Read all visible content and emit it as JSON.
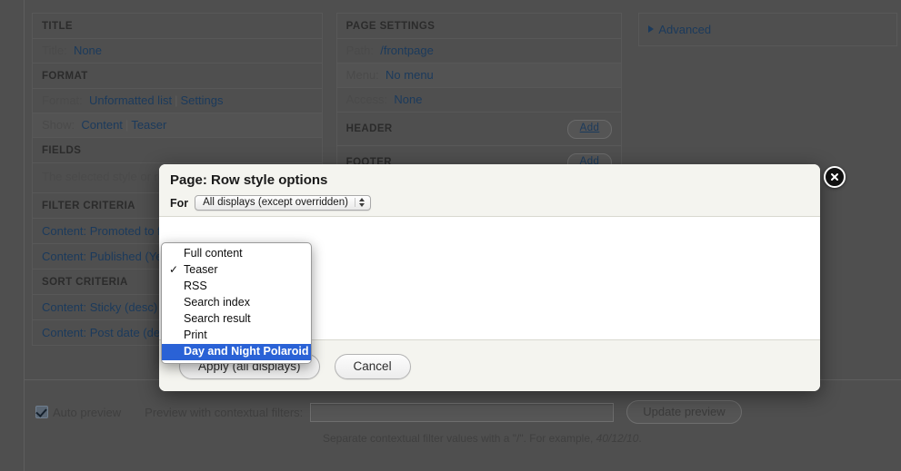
{
  "background": {
    "columns": [
      {
        "id": "col-1",
        "sections": [
          {
            "id": "title",
            "heading": "TITLE",
            "rows": [
              {
                "label": "Title:",
                "links": [
                  "None"
                ]
              }
            ]
          },
          {
            "id": "format",
            "heading": "FORMAT",
            "rows": [
              {
                "label": "Format:",
                "links": [
                  "Unformatted list",
                  "Settings"
                ]
              },
              {
                "label": "Show:",
                "links": [
                  "Content",
                  "Teaser"
                ]
              }
            ]
          },
          {
            "id": "fields",
            "heading": "FIELDS",
            "description": "The selected style or row style does not use fields."
          },
          {
            "id": "filter-criteria",
            "heading": "FILTER CRITERIA",
            "criteria": [
              "Content: Promoted to front page (= Yes)",
              "Content: Published (Yes)"
            ]
          },
          {
            "id": "sort-criteria",
            "heading": "SORT CRITERIA",
            "criteria": [
              "Content: Sticky (desc)",
              "Content: Post date (desc)"
            ]
          }
        ]
      },
      {
        "id": "col-2",
        "sections": [
          {
            "id": "page-settings",
            "heading": "PAGE SETTINGS",
            "rows": [
              {
                "label": "Path:",
                "links": [
                  "/frontpage"
                ]
              },
              {
                "label": "Menu:",
                "links": [
                  "No menu"
                ]
              },
              {
                "label": "Access:",
                "links": [
                  "None"
                ]
              }
            ]
          },
          {
            "id": "header",
            "heading": "HEADER",
            "action": "Add"
          },
          {
            "id": "footer",
            "heading": "FOOTER",
            "action": "Add"
          }
        ]
      }
    ],
    "advanced": {
      "label": "Advanced",
      "icon": "triangle-right-icon"
    }
  },
  "preview": {
    "auto_preview_label": "Auto preview",
    "auto_preview_checked": true,
    "contextual_label": "Preview with contextual filters:",
    "contextual_value": "",
    "contextual_placeholder": "",
    "update_button": "Update preview",
    "hint_prefix": "Separate contextual filter values with a \"/\". For example, ",
    "hint_example": "40/12/10",
    "hint_suffix": "."
  },
  "modal": {
    "title": "Page: Row style options",
    "for_label": "For",
    "display_select_value": "All displays (except overridden)",
    "apply_button": "Apply (all displays)",
    "cancel_button": "Cancel",
    "close_icon": "close-icon"
  },
  "dropdown": {
    "items": [
      {
        "label": "Full content",
        "checked": false,
        "selected": false
      },
      {
        "label": "Teaser",
        "checked": true,
        "selected": false
      },
      {
        "label": "RSS",
        "checked": false,
        "selected": false
      },
      {
        "label": "Search index",
        "checked": false,
        "selected": false
      },
      {
        "label": "Search result",
        "checked": false,
        "selected": false
      },
      {
        "label": "Print",
        "checked": false,
        "selected": false
      },
      {
        "label": "Day and Night Polaroid",
        "checked": false,
        "selected": true
      }
    ]
  },
  "colors": {
    "overlay_dim": "#4f4f4f",
    "link": "#1b3a5c",
    "selection_blue": "#2a62d6",
    "modal_chrome": "#f4f4ef"
  }
}
